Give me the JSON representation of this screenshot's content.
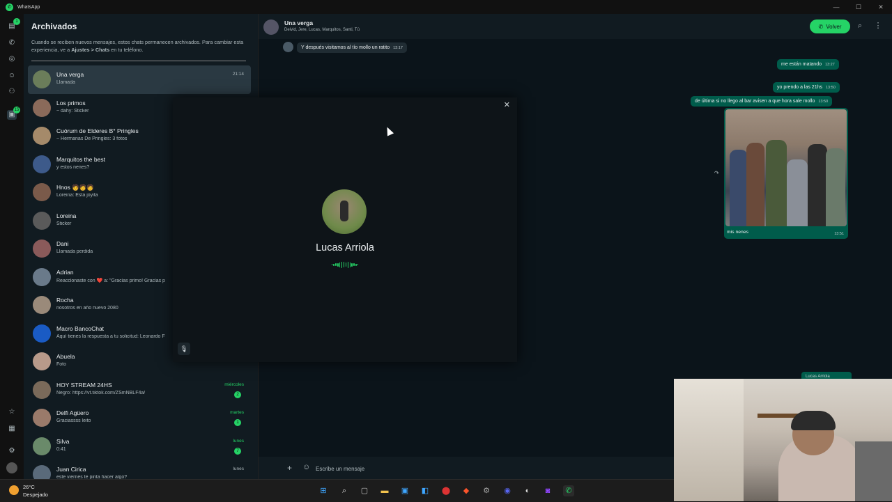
{
  "window": {
    "app_title": "WhatsApp"
  },
  "sidebar_rail": {
    "chats_badge": "1",
    "archived_badge": "15"
  },
  "archived": {
    "title": "Archivados",
    "description_1": "Cuando se reciben nuevos mensajes, estos chats permanecen archivados. Para cambiar esta experiencia, ve a ",
    "description_link": "Ajustes > Chats",
    "description_2": " en tu teléfono.",
    "chats": [
      {
        "name": "Una verga",
        "preview": "Llamada",
        "time": "21:14",
        "unread": ""
      },
      {
        "name": "Los primos",
        "preview": "~ dahy: Sticker",
        "time": "",
        "unread": ""
      },
      {
        "name": "Cuórum de Elderes B° Pringles",
        "preview": "~ Hermanas De Pringles: 3 fotos",
        "time": "",
        "unread": ""
      },
      {
        "name": "Marquitos the best",
        "preview": "y estos nenes?",
        "time": "",
        "unread": ""
      },
      {
        "name": "Hnos 🧑🧑🧑",
        "preview": "Loreina: Esta joyita",
        "time": "",
        "unread": ""
      },
      {
        "name": "Loreina",
        "preview": "Sticker",
        "time": "",
        "unread": ""
      },
      {
        "name": "Dani",
        "preview": "Llamada perdida",
        "time": "",
        "unread": ""
      },
      {
        "name": "Adrian",
        "preview": "Reaccionaste con ❤️ a: \"Gracias primo! Gracias p",
        "time": "",
        "unread": ""
      },
      {
        "name": "Rocha",
        "preview": "nosotros en año nuevo 2080",
        "time": "",
        "unread": ""
      },
      {
        "name": "Macro BancoChat",
        "preview": "Aquí tienes la respuesta a tu solicitud: Leonardo F",
        "time": "",
        "unread": ""
      },
      {
        "name": "Abuela",
        "preview": "Foto",
        "time": "",
        "unread": ""
      },
      {
        "name": "HOY STREAM 24HS",
        "preview": "Negro: https://vt.tiktok.com/ZSmNBLF4a/",
        "time": "miércoles",
        "unread": "2"
      },
      {
        "name": "Delfi Agüero",
        "preview": "Graciassss leito",
        "time": "martes",
        "unread": "1"
      },
      {
        "name": "Silva",
        "preview": "0:41",
        "time": "lunes",
        "unread": "7"
      },
      {
        "name": "Juan Cirica",
        "preview": "este viernes te pinta hacer algo?",
        "time": "lunes",
        "unread": ""
      }
    ]
  },
  "conversation": {
    "name": "Una verga",
    "members": "Deivid, Jere, Lucas, Marquitos, Santi, Tú",
    "back_button": "Volver",
    "messages": [
      {
        "text": "Y después visitamos al tío mollo un ratito",
        "time": "13:17",
        "dir": "in"
      },
      {
        "text": "me están matando",
        "time": "13:27",
        "dir": "out"
      },
      {
        "text": "yo prendo a las 21hs",
        "time": "13:50",
        "dir": "out"
      },
      {
        "text": "de última si no llego al bar avisen a que hora sale mollo",
        "time": "13:50",
        "dir": "out"
      }
    ],
    "photo_caption": "mis nenes",
    "photo_time": "13:51",
    "composer_placeholder": "Escribe un mensaje",
    "pip_label": "Lucas Arriola"
  },
  "call": {
    "caller_name": "Lucas Arriola"
  },
  "taskbar": {
    "temperature": "26°C",
    "condition": "Despejado"
  },
  "colors": {
    "accent": "#25d366",
    "outgoing_bubble": "#005c4b",
    "incoming_bubble": "#202c33"
  }
}
